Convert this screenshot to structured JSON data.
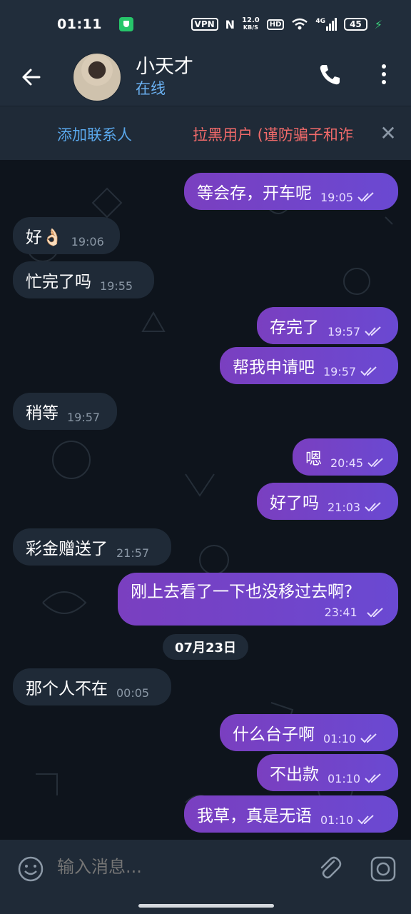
{
  "status_bar": {
    "time": "01:11",
    "vpn": "VPN",
    "nfc": "N",
    "speed_value": "12.0",
    "speed_unit": "KB/S",
    "hd": "HD",
    "network": "4G",
    "battery": "45"
  },
  "header": {
    "name": "小天才",
    "status": "在线"
  },
  "action_bar": {
    "add_contact": "添加联系人",
    "block_user": "拉黑用户 (谨防骗子和诈骗)"
  },
  "messages": [
    {
      "dir": "out",
      "text": "等会存，开车呢",
      "time": "19:05"
    },
    {
      "dir": "in",
      "text": "好👌🏻",
      "time": "19:06"
    },
    {
      "dir": "in",
      "text": "忙完了吗",
      "time": "19:55"
    },
    {
      "dir": "out",
      "text": "存完了",
      "time": "19:57"
    },
    {
      "dir": "out",
      "text": "帮我申请吧",
      "time": "19:57"
    },
    {
      "dir": "in",
      "text": "稍等",
      "time": "19:57"
    },
    {
      "dir": "out",
      "text": "嗯",
      "time": "20:45"
    },
    {
      "dir": "out",
      "text": "好了吗",
      "time": "21:03"
    },
    {
      "dir": "in",
      "text": "彩金赠送了",
      "time": "21:57"
    },
    {
      "dir": "out",
      "text": "刚上去看了一下也没移过去啊?",
      "time": "23:41"
    },
    {
      "dir": "in",
      "text": "那个人不在",
      "time": "00:05"
    },
    {
      "dir": "out",
      "text": "什么台子啊",
      "time": "01:10"
    },
    {
      "dir": "out",
      "text": "不出款",
      "time": "01:10"
    },
    {
      "dir": "out",
      "text": "我草，真是无语",
      "time": "01:10"
    }
  ],
  "date_separator": "07月23日",
  "input": {
    "placeholder": "输入消息..."
  },
  "colors": {
    "outgoing_bubble": "#7444c8",
    "incoming_bubble": "#1f2a37",
    "header": "#212d3b",
    "accent_blue": "#5aa8ec",
    "danger_red": "#f06a6a"
  }
}
